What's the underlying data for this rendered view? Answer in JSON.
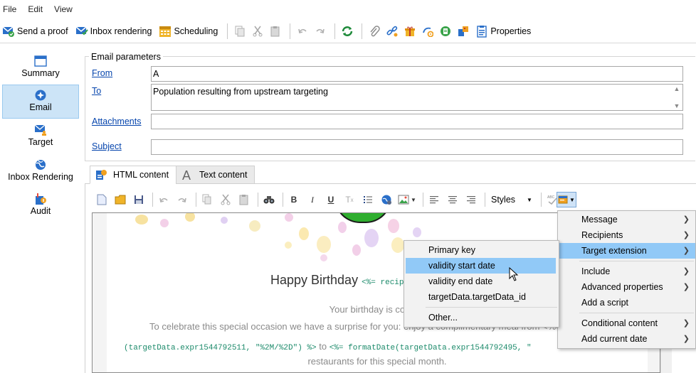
{
  "menubar": {
    "items": [
      "File",
      "Edit",
      "View"
    ]
  },
  "toolbar": {
    "send_proof": "Send a proof",
    "inbox_rendering": "Inbox rendering",
    "scheduling": "Scheduling",
    "properties": "Properties"
  },
  "nav": {
    "items": [
      {
        "label": "Summary",
        "icon": "summary-icon"
      },
      {
        "label": "Email",
        "icon": "email-icon"
      },
      {
        "label": "Target",
        "icon": "target-icon"
      },
      {
        "label": "Inbox Rendering",
        "icon": "globe-icon"
      },
      {
        "label": "Audit",
        "icon": "audit-icon"
      }
    ],
    "active": "Email"
  },
  "params": {
    "title": "Email parameters",
    "from_label": "From",
    "from_value": "A",
    "to_label": "To",
    "to_value": "Population resulting from upstream targeting",
    "attachments_label": "Attachments",
    "subject_label": "Subject"
  },
  "tabs": {
    "html": "HTML content",
    "text": "Text content"
  },
  "editor_toolbar": {
    "styles": "Styles"
  },
  "email": {
    "heading": "Happy Birthday",
    "heading_code": "<%= recip",
    "line1": "Your birthday is coming",
    "line2": "To celebrate this special occasion we have a surprise for you: enjoy a complimentary meal from <%=",
    "code_line_a": "(targetData.expr1544792511, \"%2M/%2D\") %>",
    "code_line_to": " to ",
    "code_line_b": "<%= formatDate(targetData.expr1544792495, \"",
    "line3": "restaurants for this special month."
  },
  "context_menu": {
    "items": [
      "Message",
      "Recipients",
      "Target extension",
      "Include",
      "Advanced properties",
      "Add a script",
      "Conditional content",
      "Add current date"
    ],
    "highlighted": "Target extension"
  },
  "submenu": {
    "items": [
      "Primary key",
      "validity start date",
      "validity end date",
      "targetData.targetData_id",
      "Other..."
    ],
    "highlighted": "validity start date"
  }
}
